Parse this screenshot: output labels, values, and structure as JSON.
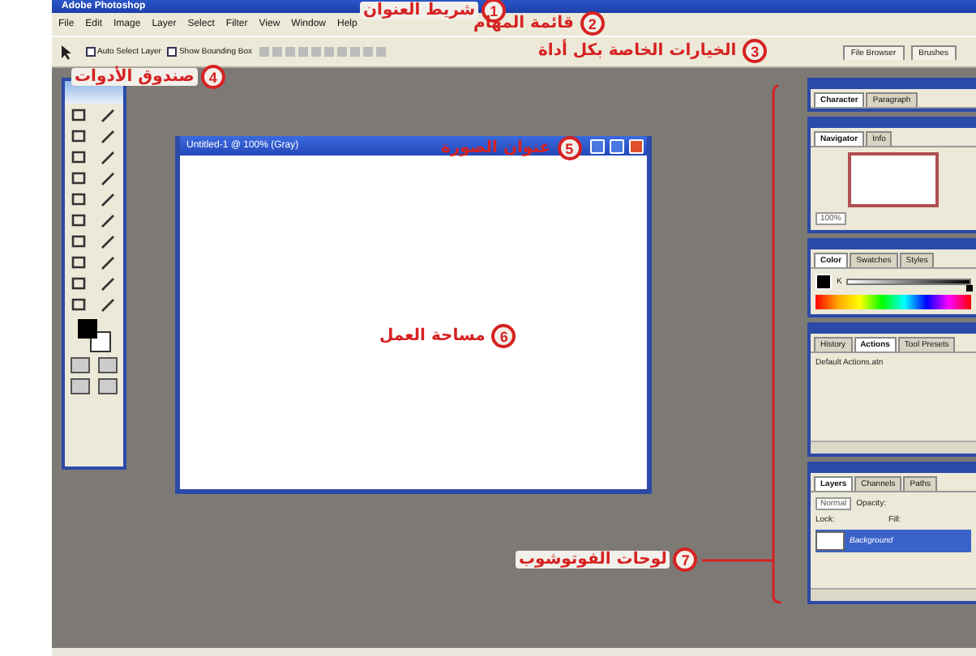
{
  "title_bar": {
    "title": "Adobe Photoshop"
  },
  "menu": [
    "File",
    "Edit",
    "Image",
    "Layer",
    "Select",
    "Filter",
    "View",
    "Window",
    "Help"
  ],
  "options_bar": {
    "checkboxes": [
      {
        "label": "Auto Select Layer",
        "checked": false
      },
      {
        "label": "Show Bounding Box",
        "checked": false
      }
    ],
    "well_tabs": [
      {
        "label": "File Browser"
      },
      {
        "label": "Brushes"
      }
    ]
  },
  "document": {
    "title": "Untitled-1 @ 100% (Gray)"
  },
  "palettes": [
    {
      "kind": "tabs",
      "tabs": [
        {
          "label": "Character",
          "selected": true
        },
        {
          "label": "Paragraph",
          "selected": false
        }
      ]
    },
    {
      "kind": "navigator",
      "tabs": [
        {
          "label": "Navigator",
          "selected": true
        },
        {
          "label": "Info",
          "selected": false
        }
      ],
      "zoom": "100%"
    },
    {
      "kind": "color",
      "tabs": [
        {
          "label": "Color",
          "selected": true
        },
        {
          "label": "Swatches",
          "selected": false
        },
        {
          "label": "Styles",
          "selected": false
        }
      ],
      "channel": "K",
      "level": 1
    },
    {
      "kind": "actions",
      "tabs": [
        {
          "label": "History",
          "selected": false
        },
        {
          "label": "Actions",
          "selected": true
        },
        {
          "label": "Tool Presets",
          "selected": false
        }
      ],
      "items": [
        "Default Actions.atn"
      ]
    },
    {
      "kind": "layers",
      "tabs": [
        {
          "label": "Layers",
          "selected": true
        },
        {
          "label": "Channels",
          "selected": false
        },
        {
          "label": "Paths",
          "selected": false
        }
      ],
      "blend_mode": "Normal",
      "opacity_label": "Opacity:",
      "lock_label": "Lock:",
      "fill_label": "Fill:",
      "layers": [
        {
          "name": "Background",
          "selected": true
        }
      ]
    }
  ],
  "annotations": [
    {
      "number": "1",
      "label": "شريط العنوان"
    },
    {
      "number": "2",
      "label": "قائمة المهام"
    },
    {
      "number": "3",
      "label": "الخيارات الخاصة بكل أداة"
    },
    {
      "number": "4",
      "label": "صندوق الأدوات"
    },
    {
      "number": "5",
      "label": "عنوان الصورة"
    },
    {
      "number": "6",
      "label": "مساحة العمل"
    },
    {
      "number": "7",
      "label": "لوحات الفوتوشوب"
    }
  ]
}
